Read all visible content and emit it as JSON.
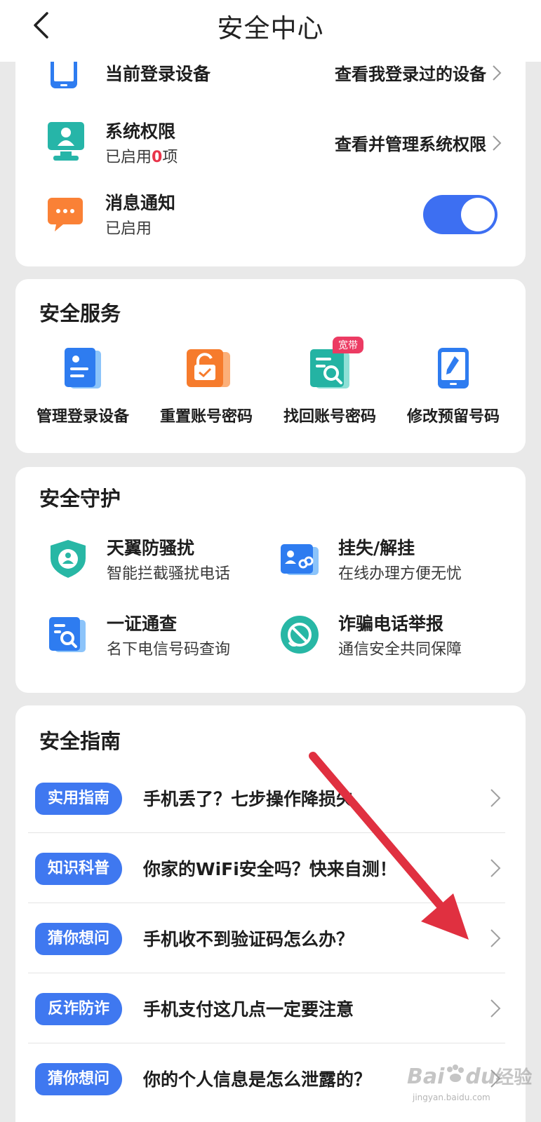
{
  "header": {
    "title": "安全中心"
  },
  "account": {
    "device": {
      "title": "当前登录设备",
      "link": "查看我登录过的设备"
    },
    "permission": {
      "title": "系统权限",
      "sub_prefix": "已启用",
      "count": "0",
      "sub_suffix": "项",
      "link": "查看并管理系统权限"
    },
    "notify": {
      "title": "消息通知",
      "sub": "已启用",
      "enabled": true
    }
  },
  "services": {
    "title": "安全服务",
    "items": [
      {
        "label": "管理登录设备",
        "icon": "device-list-icon"
      },
      {
        "label": "重置账号密码",
        "icon": "unlock-icon"
      },
      {
        "label": "找回账号密码",
        "icon": "search-document-icon",
        "badge": "宽带"
      },
      {
        "label": "修改预留号码",
        "icon": "phone-edit-icon"
      }
    ]
  },
  "protection": {
    "title": "安全守护",
    "items": [
      {
        "title": "天翼防骚扰",
        "sub": "智能拦截骚扰电话",
        "icon": "shield-user-icon"
      },
      {
        "title": "挂失/解挂",
        "sub": "在线办理方便无忧",
        "icon": "card-link-icon"
      },
      {
        "title": "一证通查",
        "sub": "名下电信号码查询",
        "icon": "id-search-icon"
      },
      {
        "title": "诈骗电话举报",
        "sub": "通信安全共同保障",
        "icon": "phone-block-icon"
      }
    ]
  },
  "guide": {
    "title": "安全指南",
    "items": [
      {
        "tag": "实用指南",
        "text": "手机丢了？七步操作降损失"
      },
      {
        "tag": "知识科普",
        "text": "你家的WiFi安全吗？快来自测！"
      },
      {
        "tag": "猜你想问",
        "text": "手机收不到验证码怎么办？"
      },
      {
        "tag": "反诈防诈",
        "text": "手机支付这几点一定要注意"
      },
      {
        "tag": "猜你想问",
        "text": "你的个人信息是怎么泄露的？"
      }
    ]
  },
  "watermark": {
    "brand": "Bai",
    "brand2": "du",
    "suffix": "经验",
    "url": "jingyan.baidu.com"
  },
  "colors": {
    "accent": "#3d6ff2",
    "tag": "#3f78f0",
    "red": "#e8344a",
    "arrow": "#e03040"
  }
}
